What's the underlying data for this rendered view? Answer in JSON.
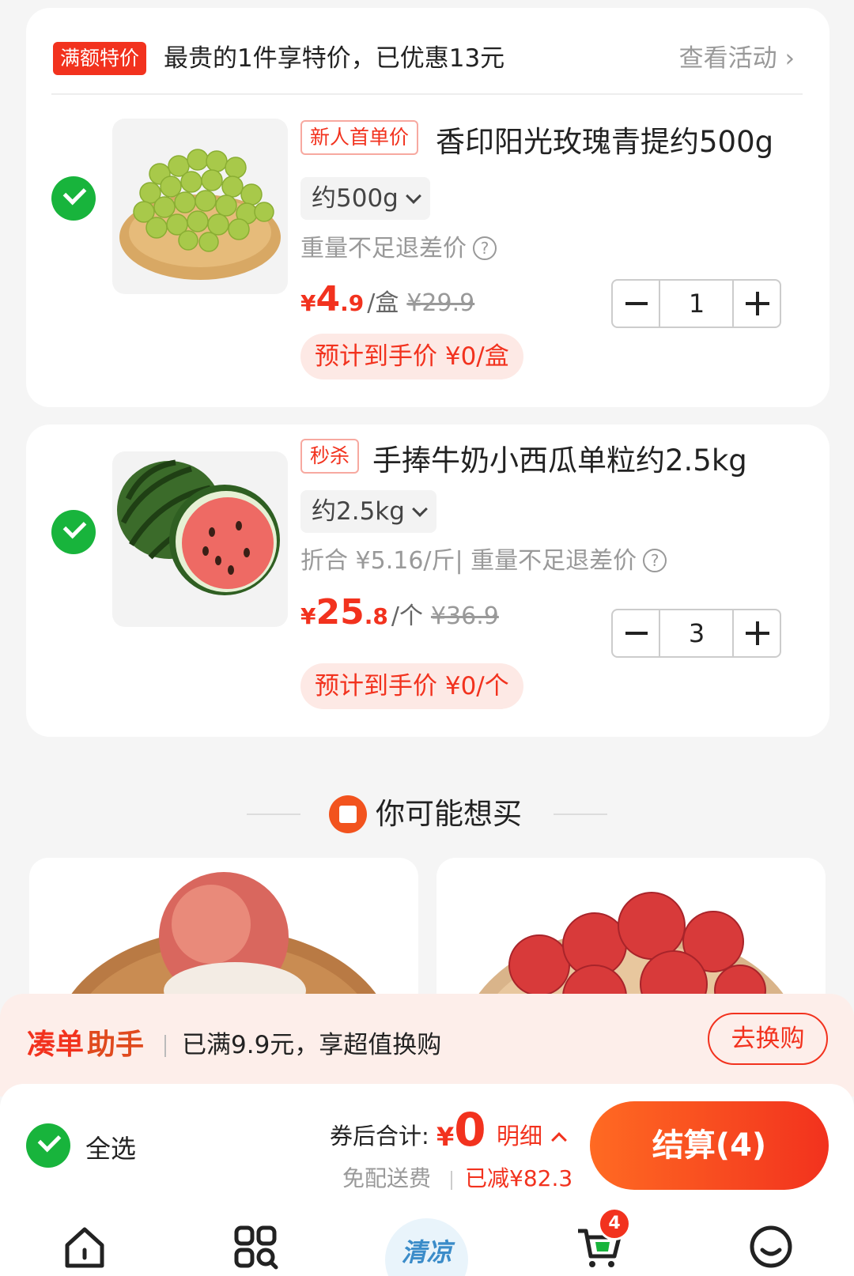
{
  "promo": {
    "tag": "满额特价",
    "text": "最贵的1件享特价，已优惠13元",
    "link": "查看活动"
  },
  "items": [
    {
      "badge": "新人首单价",
      "title": "香印阳光玫瑰青提约500g",
      "spec": "约500g",
      "note": "重量不足退差价",
      "price_symbol": "¥",
      "price_int": "4",
      "price_dec": ".9",
      "unit": "/盒",
      "orig_price": "¥29.9",
      "quantity": "1",
      "estimate": "预计到手价 ¥0/盒",
      "checked": true
    },
    {
      "badge": "秒杀",
      "title": "手捧牛奶小西瓜单粒约2.5kg",
      "spec": "约2.5kg",
      "note": "折合 ¥5.16/斤| 重量不足退差价",
      "price_symbol": "¥",
      "price_int": "25",
      "price_dec": ".8",
      "unit": "/个",
      "orig_price": "¥36.9",
      "quantity": "3",
      "estimate": "预计到手价 ¥0/个",
      "checked": true
    }
  ],
  "recommend": {
    "title": "你可能想买"
  },
  "assistant": {
    "title_a": "凑单",
    "title_b": "助手",
    "text": "已满9.9元，享超值换购",
    "button": "去换购"
  },
  "checkout": {
    "select_all": "全选",
    "sum_label": "券后合计:",
    "sum_symbol": "¥",
    "sum_value": "0",
    "detail": "明细",
    "free_delivery": "免配送费",
    "reduced": "已减¥82.3",
    "pay_button": "结算(4)"
  },
  "tabbar": {
    "cart_badge": "4",
    "center_label": "清凉",
    "icons": [
      "home-icon",
      "category-icon",
      "center-promo-icon",
      "cart-icon",
      "profile-icon"
    ]
  },
  "colors": {
    "accent": "#f2321e",
    "check": "#18b43c",
    "background": "#f5f5f5"
  }
}
